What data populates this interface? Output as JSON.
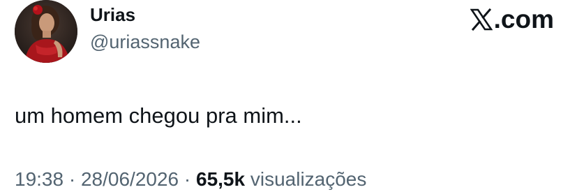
{
  "author": {
    "name": "Urias",
    "handle": "@uriassnake",
    "avatar": "profile-photo"
  },
  "brand": {
    "icon": "x-logo-icon",
    "text": ".com"
  },
  "tweet": {
    "text": "um homem chegou pra mim..."
  },
  "meta": {
    "time": "19:38",
    "separator1": " · ",
    "date": "28/06/2026",
    "separator2": " · ",
    "views_count": "65,5k",
    "views_label": " visualizações"
  },
  "colors": {
    "text_primary": "#0f1419",
    "text_secondary": "#536471",
    "background": "#ffffff"
  }
}
